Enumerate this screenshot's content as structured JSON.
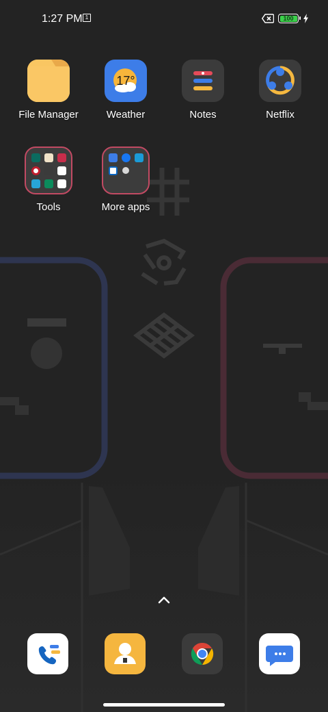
{
  "status_bar": {
    "time": "1:27 PM",
    "sim_slot": "1",
    "battery_level": "100",
    "battery_color": "#3bd14a"
  },
  "apps": [
    {
      "label": "File Manager",
      "icon": "folder-icon"
    },
    {
      "label": "Weather",
      "icon": "weather-icon",
      "temperature": "17°"
    },
    {
      "label": "Notes",
      "icon": "notes-icon"
    },
    {
      "label": "Netflix",
      "icon": "share-nodes-icon"
    }
  ],
  "folders": [
    {
      "label": "Tools",
      "accent": "#c24a63"
    },
    {
      "label": "More apps",
      "accent": "#c24a63"
    }
  ],
  "app_drawer_arrow": "chevron-up-icon",
  "dock": [
    {
      "icon": "phone-icon"
    },
    {
      "icon": "contacts-icon"
    },
    {
      "icon": "chrome-icon"
    },
    {
      "icon": "messages-icon"
    }
  ]
}
